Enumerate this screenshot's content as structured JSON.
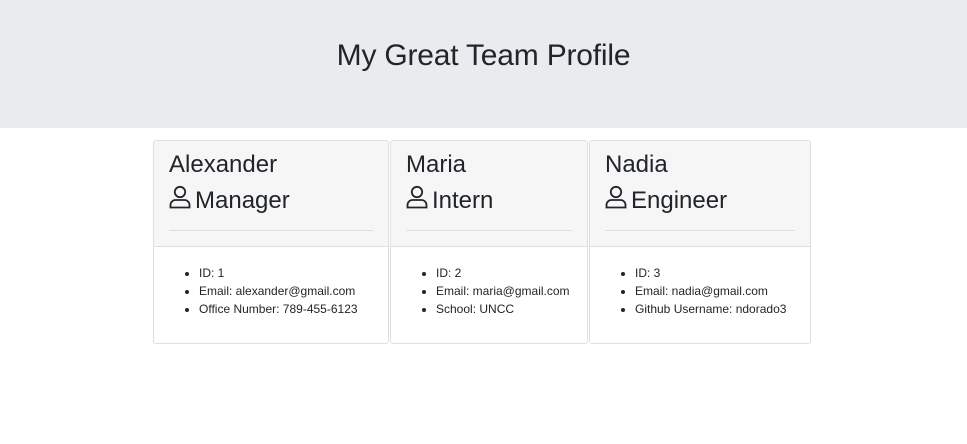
{
  "header": {
    "title": "My Great Team Profile"
  },
  "cards": [
    {
      "name": "Alexander",
      "role": "Manager",
      "role_icon": "user-icon",
      "details": [
        "ID: 1",
        "Email: alexander@gmail.com",
        "Office Number: 789-455-6123"
      ]
    },
    {
      "name": "Maria",
      "role": "Intern",
      "role_icon": "user-icon",
      "details": [
        "ID: 2",
        "Email: maria@gmail.com",
        "School: UNCC"
      ]
    },
    {
      "name": "Nadia",
      "role": "Engineer",
      "role_icon": "user-icon",
      "details": [
        "ID: 3",
        "Email: nadia@gmail.com",
        "Github Username: ndorado3"
      ]
    }
  ]
}
